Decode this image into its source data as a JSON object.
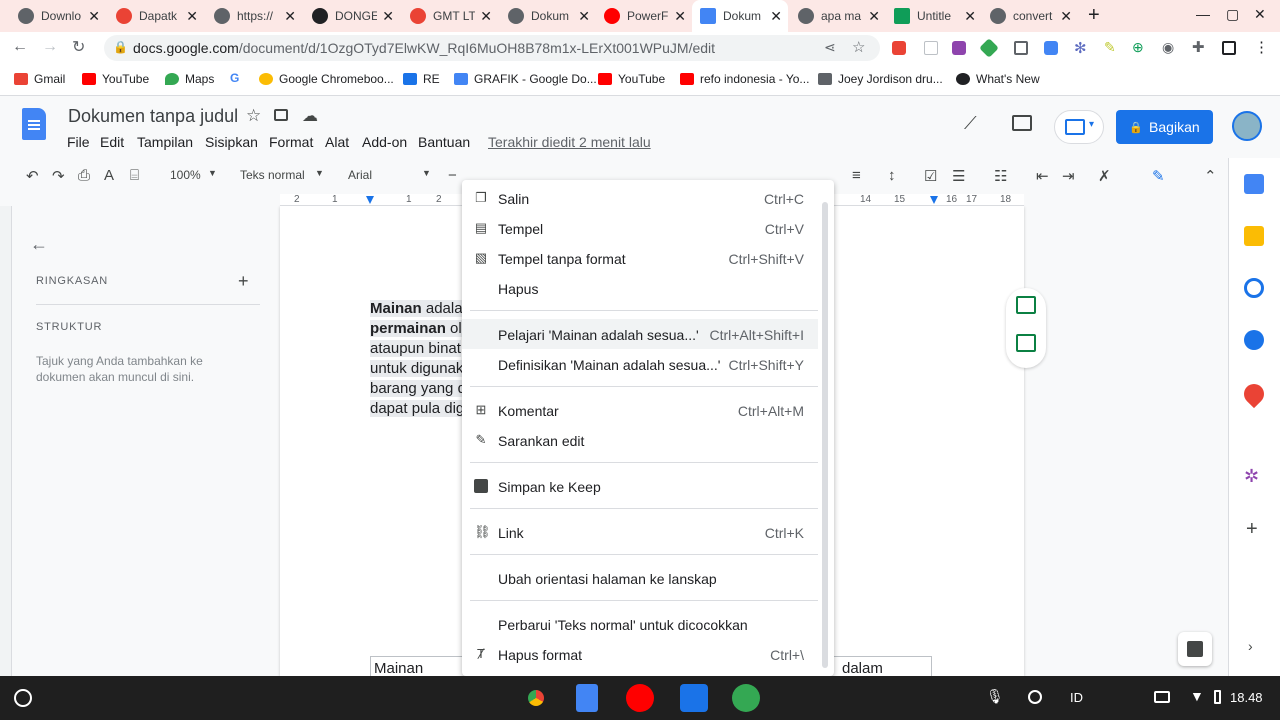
{
  "browser": {
    "tabs": [
      {
        "label": "Downlo",
        "color": "#5f6368"
      },
      {
        "label": "Dapatk",
        "color": "#ea4335"
      },
      {
        "label": "https://",
        "color": "#5f6368"
      },
      {
        "label": "DONGE",
        "color": "#202124"
      },
      {
        "label": "GMT LT",
        "color": "#ea4335"
      },
      {
        "label": "Dokum",
        "color": "#5f6368"
      },
      {
        "label": "PowerF",
        "color": "#ff0000"
      },
      {
        "label": "Dokum",
        "color": "#4285f4"
      },
      {
        "label": "apa ma",
        "color": "#5f6368"
      },
      {
        "label": "Untitle",
        "color": "#0f9d58"
      },
      {
        "label": "convert",
        "color": "#5f6368"
      }
    ],
    "new_tab": "+",
    "url_host": "docs.google.com",
    "url_path": "/document/d/1OzgOTyd7ElwKW_RqI6MuOH8B78m1x-LErXt001WPuJM/edit",
    "bookmarks": [
      {
        "label": "Gmail",
        "color": "#ea4335"
      },
      {
        "label": "YouTube",
        "color": "#ff0000"
      },
      {
        "label": "Maps",
        "color": "#34a853"
      },
      {
        "label": "",
        "color": "#4285f4"
      },
      {
        "label": "Google Chromeboo...",
        "color": "#fbbc04"
      },
      {
        "label": "RE",
        "color": "#1a73e8"
      },
      {
        "label": "GRAFIK - Google Do...",
        "color": "#4285f4"
      },
      {
        "label": "YouTube",
        "color": "#ff0000"
      },
      {
        "label": "refo indonesia - Yo...",
        "color": "#ff0000"
      },
      {
        "label": "Joey Jordison dru...",
        "color": "#5f6368"
      },
      {
        "label": "What's New",
        "color": "#202124"
      }
    ]
  },
  "docs": {
    "title": "Dokumen tanpa judul",
    "menus": [
      "File",
      "Edit",
      "Tampilan",
      "Sisipkan",
      "Format",
      "Alat",
      "Add-on",
      "Bantuan"
    ],
    "last_edit": "Terakhir diedit 2 menit lalu",
    "share": "Bagikan",
    "zoom": "100%",
    "style": "Teks normal",
    "font": "Arial",
    "ruler_left": [
      "2",
      "1",
      "1",
      "2"
    ],
    "ruler_right": [
      "14",
      "15",
      "16",
      "17",
      "18"
    ]
  },
  "outline": {
    "summary": "RINGKASAN",
    "structure": "STRUKTUR",
    "hint": "Tajuk yang Anda tambahkan ke dokumen akan muncul di sini."
  },
  "document": {
    "lines": [
      {
        "bold": "Mainan",
        "rest": " adala"
      },
      {
        "bold": "permainan",
        "rest": " ol"
      },
      {
        "bold": "",
        "rest": "ataupun binat"
      },
      {
        "bold": "",
        "rest": "untuk digunak"
      },
      {
        "bold": "",
        "rest": "barang yang d"
      },
      {
        "bold": "",
        "rest": "dapat pula dig"
      }
    ],
    "table_left": "Mainan",
    "table_right": "dalam"
  },
  "context_menu": [
    {
      "label": "Salin",
      "shortcut": "Ctrl+C",
      "icon": "copy-icon"
    },
    {
      "label": "Tempel",
      "shortcut": "Ctrl+V",
      "icon": "paste-icon"
    },
    {
      "label": "Tempel tanpa format",
      "shortcut": "Ctrl+Shift+V",
      "icon": "paste-plain-icon"
    },
    {
      "label": "Hapus",
      "shortcut": "",
      "icon": ""
    },
    {
      "label": "Pelajari 'Mainan adalah sesua...'",
      "shortcut": "Ctrl+Alt+Shift+I",
      "icon": ""
    },
    {
      "label": "Definisikan 'Mainan adalah sesua...'",
      "shortcut": "Ctrl+Shift+Y",
      "icon": ""
    },
    {
      "label": "Komentar",
      "shortcut": "Ctrl+Alt+M",
      "icon": "comment-icon"
    },
    {
      "label": "Sarankan edit",
      "shortcut": "",
      "icon": "suggest-edit-icon"
    },
    {
      "label": "Simpan ke Keep",
      "shortcut": "",
      "icon": "keep-icon"
    },
    {
      "label": "Link",
      "shortcut": "Ctrl+K",
      "icon": "link-icon"
    },
    {
      "label": "Ubah orientasi halaman ke lanskap",
      "shortcut": "",
      "icon": ""
    },
    {
      "label": "Perbarui 'Teks normal' untuk dicocokkan",
      "shortcut": "",
      "icon": ""
    },
    {
      "label": "Hapus format",
      "shortcut": "Ctrl+\\",
      "icon": "clear-format-icon"
    }
  ],
  "taskbar": {
    "ime": "ID",
    "clock": "18.48"
  },
  "colors": {
    "accent": "#1a73e8",
    "tabstrip": "#fce8e6"
  }
}
